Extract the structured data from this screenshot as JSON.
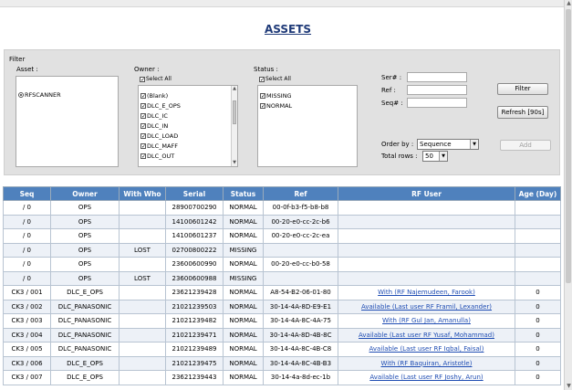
{
  "title": "ASSETS",
  "filter": {
    "legend": "Filter",
    "asset": {
      "label": "Asset :",
      "items": [
        "RFSCANNER"
      ]
    },
    "owner": {
      "label": "Owner :",
      "select_all": "Select All",
      "items": [
        "(Blank)",
        "DLC_E_OPS",
        "DLC_IC",
        "DLC_IN",
        "DLC_LOAD",
        "DLC_MAFF",
        "DLC_OUT"
      ]
    },
    "status": {
      "label": "Status :",
      "select_all": "Select All",
      "items": [
        "MISSING",
        "NORMAL"
      ]
    },
    "ser_label": "Ser# :",
    "ref_label": "Ref :",
    "seq_label": "Seq# :",
    "ser_value": "",
    "ref_value": "",
    "seq_value": "",
    "filter_button": "Filter",
    "refresh_button": "Refresh [90s]",
    "add_button": "Add",
    "order_by_label": "Order by :",
    "order_by_value": "Sequence",
    "total_rows_label": "Total rows :",
    "total_rows_value": "50"
  },
  "table": {
    "headers": [
      "Seq",
      "Owner",
      "With Who",
      "Serial",
      "Status",
      "Ref",
      "RF User",
      "Age (Day)"
    ],
    "rows": [
      [
        "/ 0",
        "OPS",
        "",
        "28900700290",
        "NORMAL",
        "00-0f-b3-f5-b8-b8",
        "",
        ""
      ],
      [
        "/ 0",
        "OPS",
        "",
        "14100601242",
        "NORMAL",
        "00-20-e0-cc-2c-b6",
        "",
        ""
      ],
      [
        "/ 0",
        "OPS",
        "",
        "14100601237",
        "NORMAL",
        "00-20-e0-cc-2c-ea",
        "",
        ""
      ],
      [
        "/ 0",
        "OPS",
        "LOST",
        "02700800222",
        "MISSING",
        "",
        "",
        ""
      ],
      [
        "/ 0",
        "OPS",
        "",
        "23600600990",
        "NORMAL",
        "00-20-e0-cc-b0-58",
        "",
        ""
      ],
      [
        "/ 0",
        "OPS",
        "LOST",
        "23600600988",
        "MISSING",
        "",
        "",
        ""
      ],
      [
        "CK3 / 001",
        "DLC_E_OPS",
        "",
        "23621239428",
        "NORMAL",
        "A8-54-B2-06-01-80",
        "With (RF Najemudeen, Farook)",
        "0"
      ],
      [
        "CK3 / 002",
        "DLC_PANASONIC",
        "",
        "21021239503",
        "NORMAL",
        "30-14-4A-8D-E9-E1",
        "Available (Last user RF Framil, Lexander)",
        "0"
      ],
      [
        "CK3 / 003",
        "DLC_PANASONIC",
        "",
        "21021239482",
        "NORMAL",
        "30-14-4A-8C-4A-75",
        "With (RF Gul Jan, Amanulla)",
        "0"
      ],
      [
        "CK3 / 004",
        "DLC_PANASONIC",
        "",
        "21021239471",
        "NORMAL",
        "30-14-4A-8D-4B-8C",
        "Available (Last user RF Yusaf, Mohammad)",
        "0"
      ],
      [
        "CK3 / 005",
        "DLC_PANASONIC",
        "",
        "21021239489",
        "NORMAL",
        "30-14-4A-8C-4B-C8",
        "Available (Last user RF Iqbal, Faisal)",
        "0"
      ],
      [
        "CK3 / 006",
        "DLC_E_OPS",
        "",
        "21021239475",
        "NORMAL",
        "30-14-4A-8C-4B-B3",
        "With (RF Baquiran, Aristotle)",
        "0"
      ],
      [
        "CK3 / 007",
        "DLC_E_OPS",
        "",
        "23621239443",
        "NORMAL",
        "30-14-4a-8d-ec-1b",
        "Available (Last user RF Joshy, Arun)",
        "0"
      ]
    ]
  }
}
